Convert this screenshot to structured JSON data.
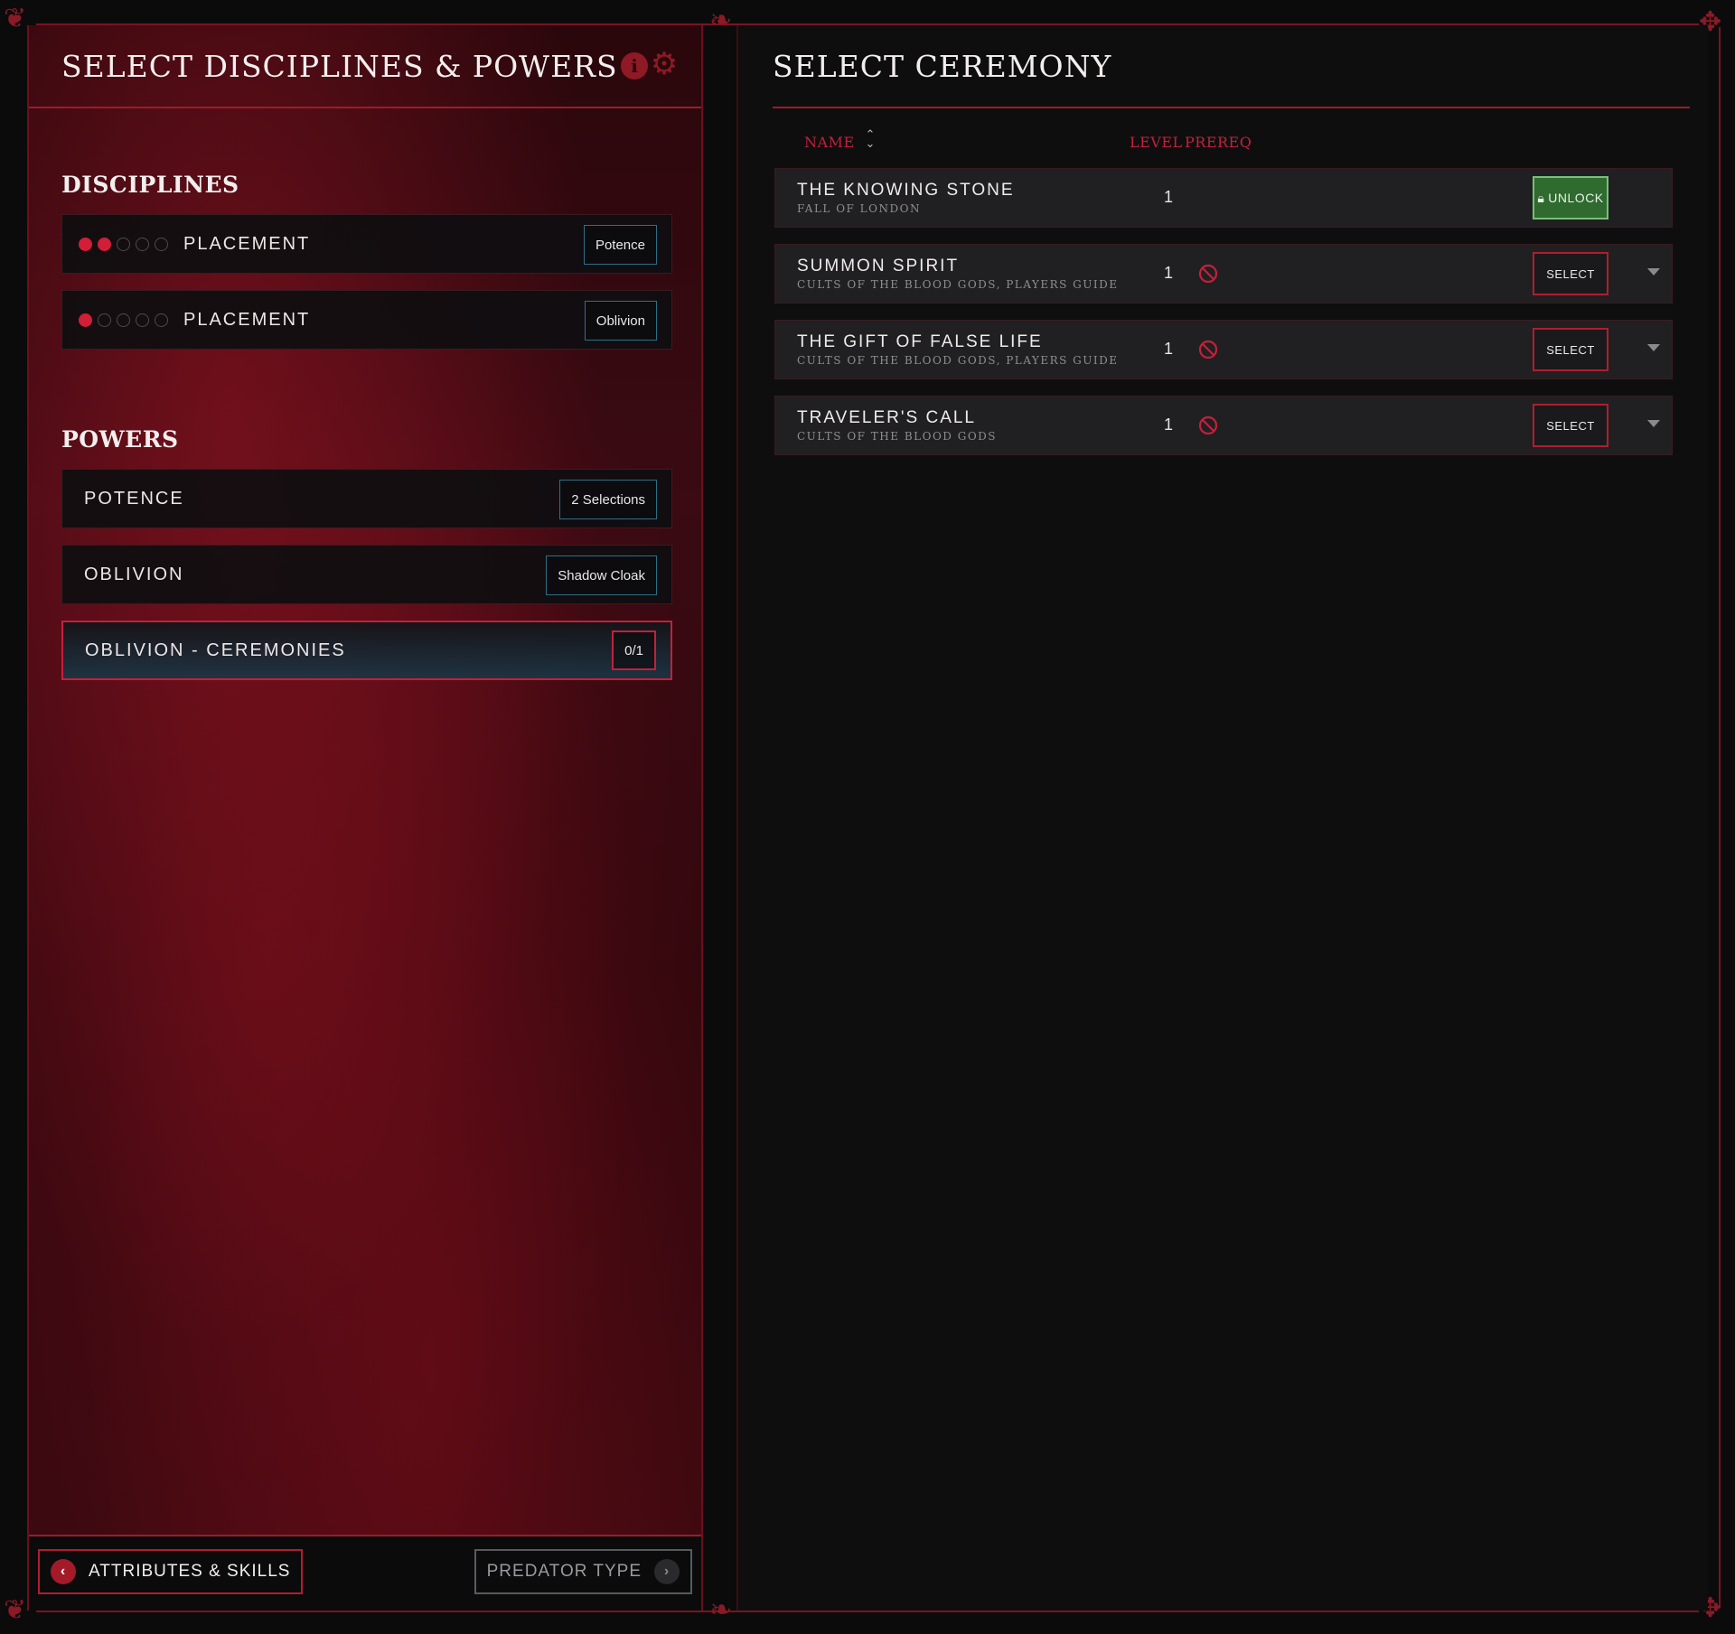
{
  "left": {
    "title": "SELECT DISCIPLINES & POWERS",
    "info_icon": "info-icon",
    "settings_icon": "gear-icon",
    "disciplines_heading": "DISCIPLINES",
    "disciplines": [
      {
        "label": "PLACEMENT",
        "dots_filled": 2,
        "dots_total": 5,
        "tag": "Potence"
      },
      {
        "label": "PLACEMENT",
        "dots_filled": 1,
        "dots_total": 5,
        "tag": "Oblivion"
      }
    ],
    "powers_heading": "POWERS",
    "powers": [
      {
        "label": "POTENCE",
        "tag": "2 Selections",
        "active": false
      },
      {
        "label": "OBLIVION",
        "tag": "Shadow Cloak",
        "active": false
      },
      {
        "label": "OBLIVION - CEREMONIES",
        "tag": "0/1",
        "active": true
      }
    ],
    "footer": {
      "back_label": "ATTRIBUTES & SKILLS",
      "next_label": "PREDATOR TYPE"
    }
  },
  "right": {
    "title": "SELECT CEREMONY",
    "columns": {
      "name": "NAME",
      "level": "LEVEL",
      "prereq": "PREREQ"
    },
    "ceremonies": [
      {
        "name": "THE KNOWING STONE",
        "source": "FALL OF LONDON",
        "level": "1",
        "prereq_blocked": false,
        "action": "UNLOCK",
        "locked": true,
        "expandable": false
      },
      {
        "name": "SUMMON SPIRIT",
        "source": "CULTS OF THE BLOOD GODS, PLAYERS GUIDE",
        "level": "1",
        "prereq_blocked": true,
        "action": "SELECT",
        "locked": false,
        "expandable": true
      },
      {
        "name": "THE GIFT OF FALSE LIFE",
        "source": "CULTS OF THE BLOOD GODS, PLAYERS GUIDE",
        "level": "1",
        "prereq_blocked": true,
        "action": "SELECT",
        "locked": false,
        "expandable": true
      },
      {
        "name": "TRAVELER'S CALL",
        "source": "CULTS OF THE BLOOD GODS",
        "level": "1",
        "prereq_blocked": true,
        "action": "SELECT",
        "locked": false,
        "expandable": true
      }
    ]
  },
  "colors": {
    "accent_red": "#c4203a",
    "unlock_green": "#2f6a2e",
    "tag_border_teal": "#2f6f86"
  }
}
